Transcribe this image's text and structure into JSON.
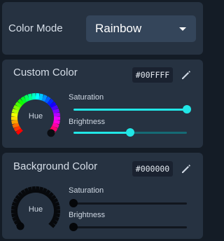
{
  "mode": {
    "label": "Color Mode",
    "value": "Rainbow"
  },
  "custom": {
    "title": "Custom Color",
    "hex": "#00FFFF",
    "hue_label": "Hue",
    "saturation": {
      "label": "Saturation",
      "value": 1.0
    },
    "brightness": {
      "label": "Brightness",
      "value": 0.5
    },
    "accent": "#21e6e6"
  },
  "background": {
    "title": "Background Color",
    "hex": "#000000",
    "hue_label": "Hue",
    "saturation": {
      "label": "Saturation",
      "value": 0.0
    },
    "brightness": {
      "label": "Brightness",
      "value": 0.0
    }
  },
  "icons": {
    "edit": "pencil-icon"
  }
}
